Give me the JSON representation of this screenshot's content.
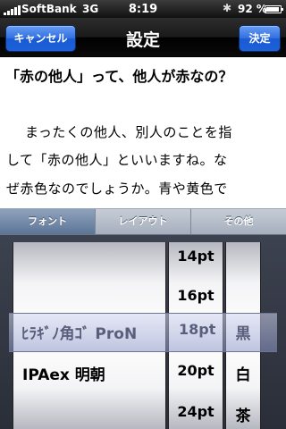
{
  "status": {
    "carrier": "SoftBank",
    "network": "3G",
    "time": "8:19",
    "battery_text": "92 %",
    "battery_level": 0.92
  },
  "nav": {
    "cancel": "キャンセル",
    "title": "設定",
    "done": "決定"
  },
  "article": {
    "heading": "「赤の他人」って、他人が赤なの？",
    "lines": [
      "まったくの他人、別人のことを指",
      "して「赤の他人」といいますね。な",
      "ぜ赤色なのでしょうか。青や黄色で"
    ]
  },
  "tabs": [
    {
      "label": "フォント",
      "active": true
    },
    {
      "label": "レイアウト",
      "active": false
    },
    {
      "label": "その他",
      "active": false
    }
  ],
  "picker": {
    "fonts": [
      "",
      "ﾋﾗｷﾞﾉ角ｺﾞ ProN",
      "IPAex 明朝"
    ],
    "sizes": [
      "14pt",
      "16pt",
      "18pt",
      "20pt",
      "24pt"
    ],
    "colors": [
      "",
      "黒",
      "白",
      "茶"
    ],
    "selected": {
      "font": "ﾋﾗｷﾞﾉ角ｺﾞ ProN",
      "size": "18pt",
      "color": "黒"
    }
  }
}
